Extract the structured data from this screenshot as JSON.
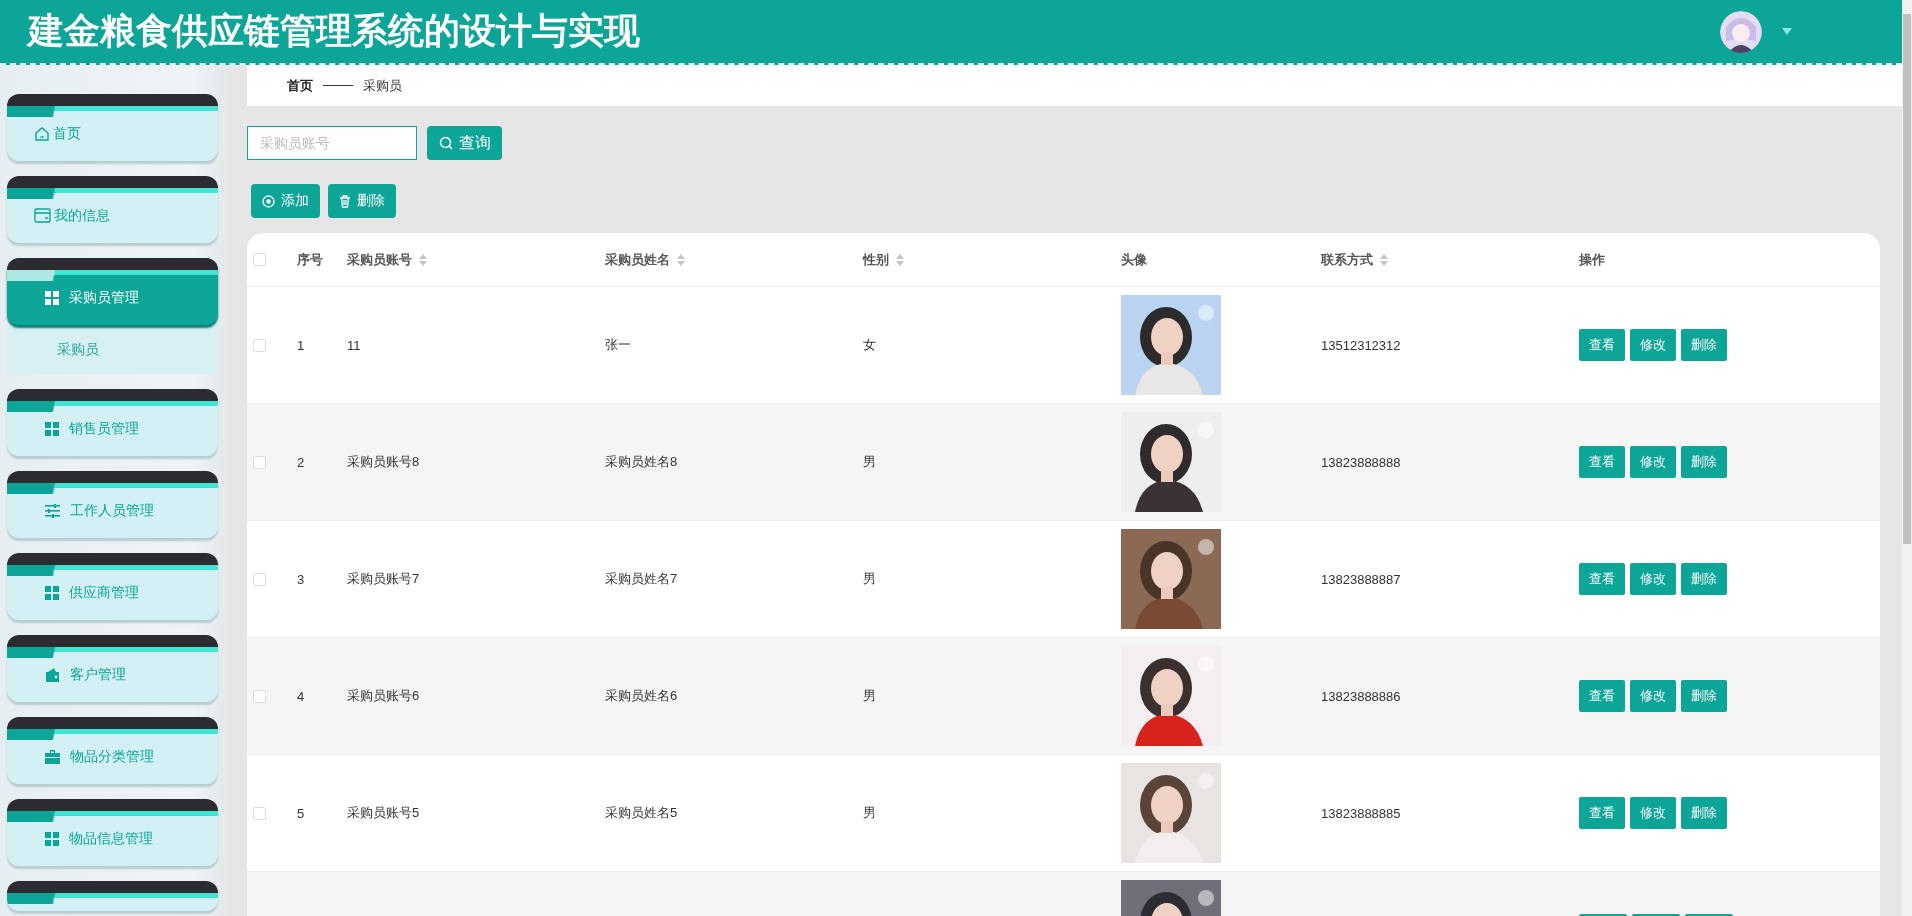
{
  "header": {
    "title": "建金粮食供应链管理系统的设计与实现"
  },
  "sidebar": {
    "items": [
      {
        "label": "首页",
        "kind": "home",
        "selected": false
      },
      {
        "label": "我的信息",
        "kind": "card",
        "selected": false
      },
      {
        "label": "采购员管理",
        "kind": "grid",
        "selected": true,
        "children": [
          {
            "label": "采购员",
            "selected": false
          }
        ]
      },
      {
        "label": "销售员管理",
        "kind": "grid",
        "selected": false
      },
      {
        "label": "工作人员管理",
        "kind": "sliders",
        "selected": false
      },
      {
        "label": "供应商管理",
        "kind": "grid",
        "selected": false
      },
      {
        "label": "客户管理",
        "kind": "wallet",
        "selected": false
      },
      {
        "label": "物品分类管理",
        "kind": "briefcase",
        "selected": false
      },
      {
        "label": "物品信息管理",
        "kind": "grid",
        "selected": false
      },
      {
        "kind": "cut"
      }
    ]
  },
  "breadcrumb": [
    "首页",
    "采购员"
  ],
  "search": {
    "placeholder": "采购员账号",
    "button": "查询"
  },
  "actions": [
    {
      "label": "添加",
      "kind": "add"
    },
    {
      "label": "删除",
      "kind": "delete"
    }
  ],
  "table": {
    "select_all": {
      "checked": false
    },
    "columns": [
      {
        "label": "序号",
        "sortable": false
      },
      {
        "label": "采购员账号",
        "sortable": true
      },
      {
        "label": "采购员姓名",
        "sortable": true
      },
      {
        "label": "性别",
        "sortable": true
      },
      {
        "label": "头像",
        "sortable": false
      },
      {
        "label": "联系方式",
        "sortable": true
      },
      {
        "label": "操作",
        "sortable": false
      }
    ],
    "rows": [
      {
        "checked": false,
        "index": "1",
        "account": "11",
        "name": "张一",
        "gender": "女",
        "phone": "13512312312",
        "buttons": [
          "查看",
          "修改",
          "删除"
        ]
      },
      {
        "checked": false,
        "index": "2",
        "account": "采购员账号8",
        "name": "采购员姓名8",
        "gender": "男",
        "phone": "13823888888",
        "buttons": [
          "查看",
          "修改",
          "删除"
        ]
      },
      {
        "checked": false,
        "index": "3",
        "account": "采购员账号7",
        "name": "采购员姓名7",
        "gender": "男",
        "phone": "13823888887",
        "buttons": [
          "查看",
          "修改",
          "删除"
        ]
      },
      {
        "checked": false,
        "index": "4",
        "account": "采购员账号6",
        "name": "采购员姓名6",
        "gender": "男",
        "phone": "13823888886",
        "buttons": [
          "查看",
          "修改",
          "删除"
        ]
      },
      {
        "checked": false,
        "index": "5",
        "account": "采购员账号5",
        "name": "采购员姓名5",
        "gender": "男",
        "phone": "13823888885",
        "buttons": [
          "查看",
          "修改",
          "删除"
        ]
      },
      {
        "kind": "cut",
        "buttons": [
          {
            "kind": "button"
          },
          {
            "kind": "button"
          },
          {
            "kind": "button"
          }
        ]
      }
    ]
  }
}
